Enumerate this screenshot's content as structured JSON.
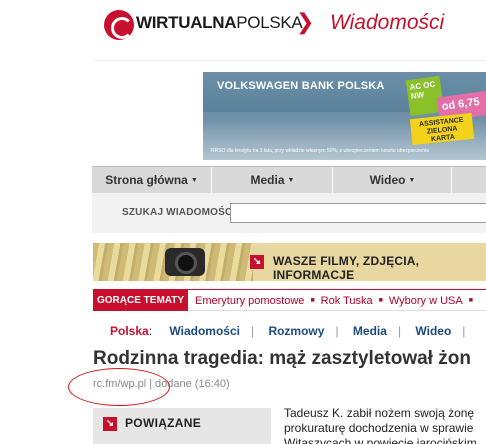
{
  "header": {
    "logo_bold": "WIRTUALNA",
    "logo_light": "POLSKA",
    "section": "Wiadomości"
  },
  "ad": {
    "title": "VOLKSWAGEN BANK POLSKA",
    "box1": "AC OC NW",
    "box2": "od 6,75",
    "box3": "ASSISTANCE ZIELONA KARTA",
    "note": "RRSO dla kredytu na 3 lata, przy wkładzie własnym 50%, z ubezpieczeniem kosztu ubezpieczenia"
  },
  "nav": {
    "tabs": [
      {
        "label": "Strona główna"
      },
      {
        "label": "Media"
      },
      {
        "label": "Wideo"
      }
    ]
  },
  "search": {
    "label": "SZUKAJ WIADOMOŚCI:",
    "value": ""
  },
  "promo": {
    "text": "WASZE FILMY, ZDJĘCIA, INFORMACJE"
  },
  "hot_topics": {
    "label": "GORĄCE TEMATY",
    "items": [
      "Emerytury pomostowe",
      "Rok Tuska",
      "Wybory w USA"
    ]
  },
  "subnav": {
    "current": "Polska",
    "links": [
      "Wiadomości",
      "Rozmowy",
      "Media",
      "Wideo"
    ]
  },
  "article": {
    "headline": "Rodzinna tragedia: mąż zasztyletował żon",
    "source": "rc.fm/wp.pl",
    "added": "dodane (16:40)",
    "related_label": "POWIĄZANE",
    "lines": [
      "Tadeusz K. zabił nożem swoją żonę",
      "prokuraturę dochodzenia w sprawie",
      "Witaszycach w powiecie jarocińskim"
    ]
  },
  "colors": {
    "accent": "#c8102e",
    "link": "#1d4a7e",
    "annotation_circle": "#d01818"
  }
}
